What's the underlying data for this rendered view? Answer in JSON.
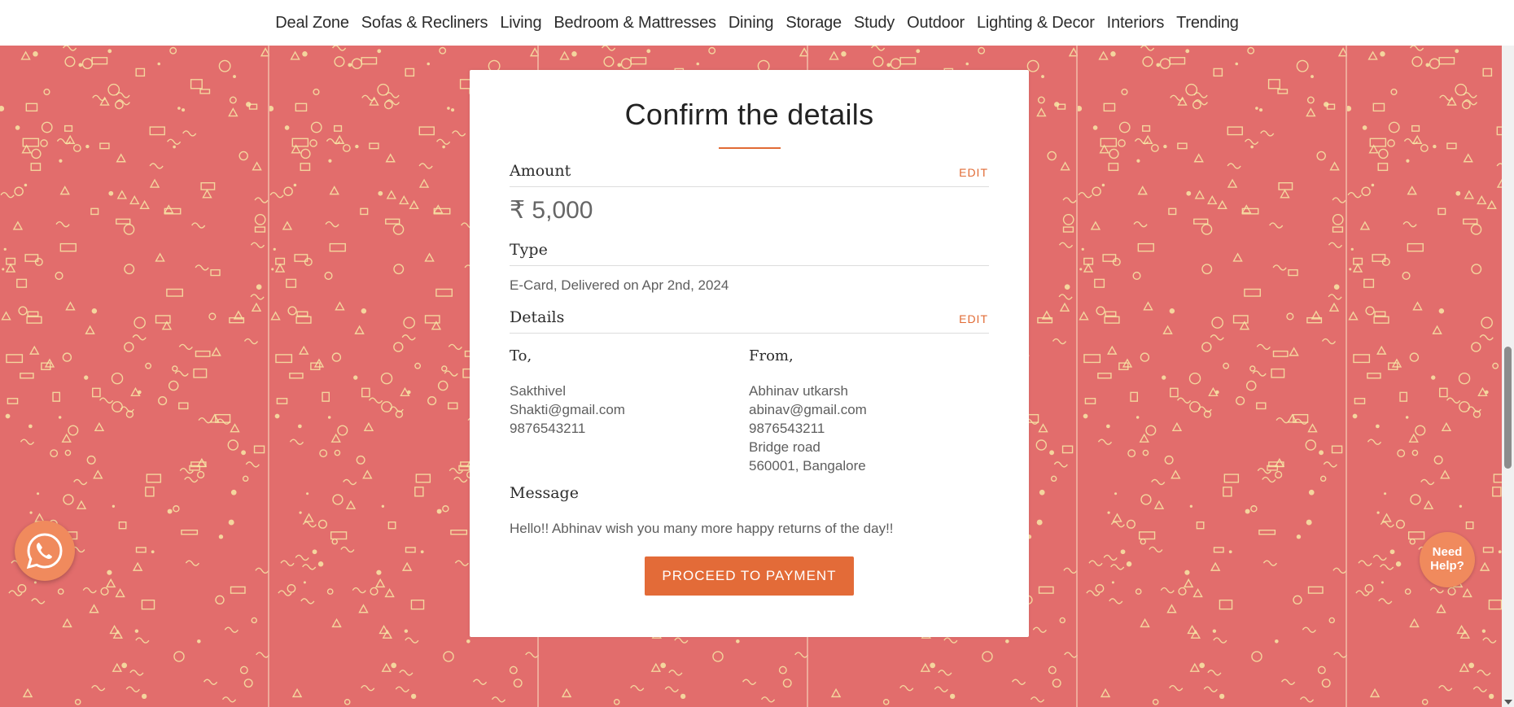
{
  "nav": {
    "items": [
      "Deal Zone",
      "Sofas & Recliners",
      "Living",
      "Bedroom & Mattresses",
      "Dining",
      "Storage",
      "Study",
      "Outdoor",
      "Lighting & Decor",
      "Interiors",
      "Trending"
    ]
  },
  "card": {
    "title": "Confirm the details",
    "amount_label": "Amount",
    "amount_value": "₹ 5,000",
    "edit_label": "EDIT",
    "type_label": "Type",
    "type_value": "E-Card, Delivered on Apr 2nd, 2024",
    "details_label": "Details",
    "to": {
      "heading": "To,",
      "name": "Sakthivel",
      "email": "Shakti@gmail.com",
      "phone": "9876543211"
    },
    "from": {
      "heading": "From,",
      "name": "Abhinav utkarsh",
      "email": "abinav@gmail.com",
      "phone": "9876543211",
      "address_line": "Bridge road",
      "city_line": "560001, Bangalore"
    },
    "message_label": "Message",
    "message_value": "Hello!! Abhinav wish you many more happy returns of the day!!",
    "pay_button": "PROCEED TO PAYMENT"
  },
  "help_widget": "Need Help?",
  "colors": {
    "accent": "#e16b35",
    "background_pattern": "#e26d6c",
    "pattern_ink": "#f7e7a6"
  },
  "icons": [
    "whatsapp-icon",
    "birthday-pattern"
  ]
}
